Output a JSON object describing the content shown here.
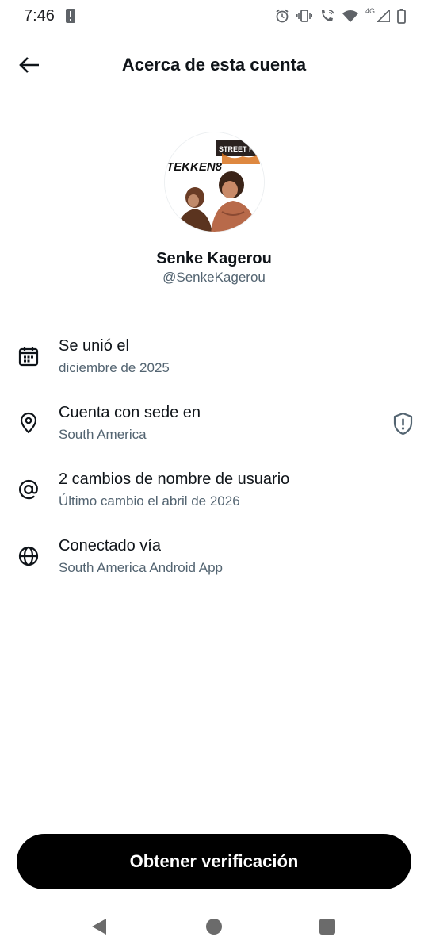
{
  "status_bar": {
    "time": "7:46",
    "network_label": "4G",
    "icons": [
      "alert-icon",
      "alarm-icon",
      "vibrate-icon",
      "wifi-calling-icon",
      "wifi-icon",
      "signal-icon",
      "battery-icon"
    ]
  },
  "header": {
    "title": "Acerca de esta cuenta",
    "back_icon": "arrow-left-icon"
  },
  "profile": {
    "name": "Senke Kagerou",
    "handle": "@SenkeKagerou",
    "avatar_text_1": "TEKKEN8",
    "avatar_text_2": "STREET FIGH"
  },
  "details": [
    {
      "icon": "calendar-icon",
      "label": "Se unió el",
      "value": "diciembre de 2025"
    },
    {
      "icon": "location-pin-icon",
      "label": "Cuenta con sede en",
      "value": "South America",
      "extra_icon": "shield-alert-icon"
    },
    {
      "icon": "at-sign-icon",
      "label": "2 cambios de nombre de usuario",
      "value": "Último cambio el abril de 2026"
    },
    {
      "icon": "globe-icon",
      "label": "Conectado vía",
      "value": "South America Android App"
    }
  ],
  "actions": {
    "verify_label": "Obtener verificación"
  },
  "colors": {
    "primary_text": "#0f1419",
    "secondary_text": "#536471",
    "button_bg": "#000000",
    "button_text": "#ffffff"
  }
}
